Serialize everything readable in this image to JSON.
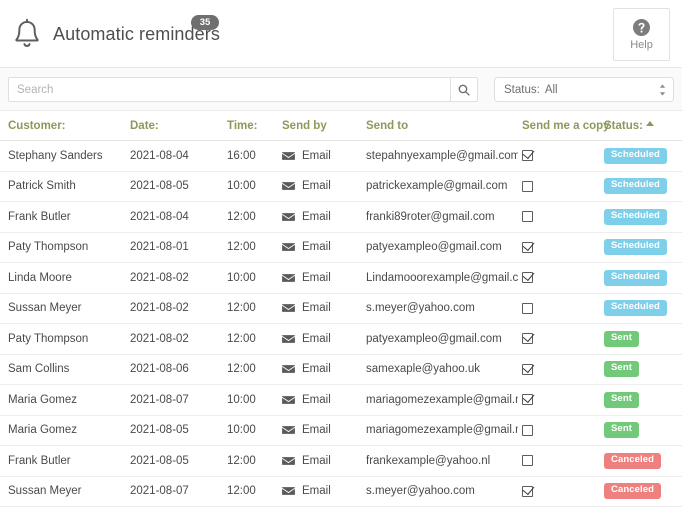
{
  "header": {
    "title": "Automatic reminders",
    "count_badge": "35",
    "bell_icon": "bell-icon",
    "help": {
      "label": "Help",
      "icon": "question-circle-icon"
    }
  },
  "filter_bar": {
    "search": {
      "placeholder": "Search",
      "value": "",
      "button_icon": "search-icon"
    },
    "status_filter": {
      "label": "Status:",
      "value": "All",
      "icon": "spinner-updown-icon"
    }
  },
  "table": {
    "columns": [
      {
        "key": "customer",
        "label": "Customer:"
      },
      {
        "key": "date",
        "label": "Date:"
      },
      {
        "key": "time",
        "label": "Time:"
      },
      {
        "key": "send_by",
        "label": "Send by"
      },
      {
        "key": "send_to",
        "label": "Send to"
      },
      {
        "key": "send_me_a_copy",
        "label": "Send me a copy"
      },
      {
        "key": "status",
        "label": "Status:"
      }
    ],
    "sorted_column": "status",
    "sort_direction": "asc",
    "rows": [
      {
        "customer": "Stephany Sanders",
        "date": "2021-08-04",
        "time": "16:00",
        "send_by": "Email",
        "send_to": "stepahnyexample@gmail.com",
        "send_me_a_copy": true,
        "status": "Scheduled"
      },
      {
        "customer": "Patrick Smith",
        "date": "2021-08-05",
        "time": "10:00",
        "send_by": "Email",
        "send_to": "patrickexample@gmail.com",
        "send_me_a_copy": false,
        "status": "Scheduled"
      },
      {
        "customer": "Frank Butler",
        "date": "2021-08-04",
        "time": "12:00",
        "send_by": "Email",
        "send_to": "franki89roter@gmail.com",
        "send_me_a_copy": false,
        "status": "Scheduled"
      },
      {
        "customer": "Paty Thompson",
        "date": "2021-08-01",
        "time": "12:00",
        "send_by": "Email",
        "send_to": "patyexampleo@gmail.com",
        "send_me_a_copy": true,
        "status": "Scheduled"
      },
      {
        "customer": "Linda Moore",
        "date": "2021-08-02",
        "time": "10:00",
        "send_by": "Email",
        "send_to": "Lindamooorexample@gmail.com",
        "send_me_a_copy": true,
        "status": "Scheduled"
      },
      {
        "customer": "Sussan Meyer",
        "date": "2021-08-02",
        "time": "12:00",
        "send_by": "Email",
        "send_to": "s.meyer@yahoo.com",
        "send_me_a_copy": false,
        "status": "Scheduled"
      },
      {
        "customer": "Paty Thompson",
        "date": "2021-08-02",
        "time": "12:00",
        "send_by": "Email",
        "send_to": "patyexampleo@gmail.com",
        "send_me_a_copy": true,
        "status": "Sent"
      },
      {
        "customer": "Sam Collins",
        "date": "2021-08-06",
        "time": "12:00",
        "send_by": "Email",
        "send_to": "samexaple@yahoo.uk",
        "send_me_a_copy": true,
        "status": "Sent"
      },
      {
        "customer": "Maria Gomez",
        "date": "2021-08-07",
        "time": "10:00",
        "send_by": "Email",
        "send_to": "mariagomezexample@gmail.mx",
        "send_me_a_copy": true,
        "status": "Sent"
      },
      {
        "customer": "Maria Gomez",
        "date": "2021-08-05",
        "time": "10:00",
        "send_by": "Email",
        "send_to": "mariagomezexample@gmail.mx",
        "send_me_a_copy": false,
        "status": "Sent"
      },
      {
        "customer": "Frank Butler",
        "date": "2021-08-05",
        "time": "12:00",
        "send_by": "Email",
        "send_to": "frankexample@yahoo.nl",
        "send_me_a_copy": false,
        "status": "Canceled"
      },
      {
        "customer": "Sussan Meyer",
        "date": "2021-08-07",
        "time": "12:00",
        "send_by": "Email",
        "send_to": "s.meyer@yahoo.com",
        "send_me_a_copy": true,
        "status": "Canceled"
      }
    ]
  },
  "colors": {
    "header_text": "#8a9a5b",
    "scheduled": "#7ed0ea",
    "sent": "#72c97a",
    "canceled": "#ef8080",
    "count_badge": "#6f6f6f"
  }
}
